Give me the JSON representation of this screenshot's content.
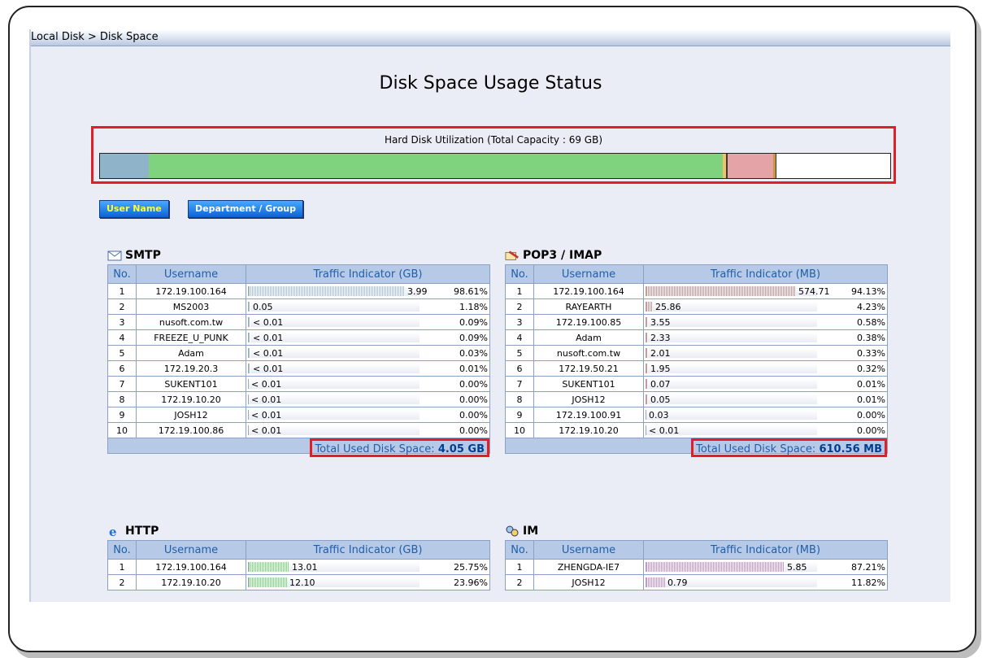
{
  "breadcrumb": "Local Disk > Disk Space",
  "page_title": "Disk Space Usage Status",
  "hard_disk": {
    "label": "Hard Disk Utilization (Total Capacity : 69 GB)",
    "segments": [
      {
        "color": "#8fb3c9",
        "fraction": 0.062
      },
      {
        "color": "#7fd37f",
        "fraction": 0.726
      },
      {
        "color": "#f2c26b",
        "fraction": 0.004
      },
      {
        "color": "#3a3a3a",
        "fraction": 0.002
      },
      {
        "color": "#e4a3a6",
        "fraction": 0.058
      },
      {
        "color": "#c99a3a",
        "fraction": 0.003
      }
    ]
  },
  "buttons": {
    "user_name": "User Name",
    "department_group": "Department / Group"
  },
  "sections": [
    {
      "key": "smtp",
      "title": "SMTP",
      "icon": "envelope-icon",
      "bar_color": "#a9c3d9",
      "headers": [
        "No.",
        "Username",
        "Traffic Indicator (GB)"
      ],
      "rows": [
        {
          "no": "1",
          "user": "172.19.100.164",
          "value": "3.99",
          "pct": "98.61%",
          "fraction": 0.9861
        },
        {
          "no": "2",
          "user": "MS2003",
          "value": "0.05",
          "pct": "1.18%",
          "fraction": 0.0118
        },
        {
          "no": "3",
          "user": "nusoft.com.tw",
          "value": "< 0.01",
          "pct": "0.09%",
          "fraction": 0.0009
        },
        {
          "no": "4",
          "user": "FREEZE_U_PUNK",
          "value": "< 0.01",
          "pct": "0.09%",
          "fraction": 0.0009
        },
        {
          "no": "5",
          "user": "Adam",
          "value": "< 0.01",
          "pct": "0.03%",
          "fraction": 0.0003
        },
        {
          "no": "6",
          "user": "172.19.20.3",
          "value": "< 0.01",
          "pct": "0.01%",
          "fraction": 0.0001
        },
        {
          "no": "7",
          "user": "SUKENT101",
          "value": "< 0.01",
          "pct": "0.00%",
          "fraction": 0
        },
        {
          "no": "8",
          "user": "172.19.10.20",
          "value": "< 0.01",
          "pct": "0.00%",
          "fraction": 0
        },
        {
          "no": "9",
          "user": "JOSH12",
          "value": "< 0.01",
          "pct": "0.00%",
          "fraction": 0
        },
        {
          "no": "10",
          "user": "172.19.100.86",
          "value": "< 0.01",
          "pct": "0.00%",
          "fraction": 0
        }
      ],
      "total_label": "Total Used Disk Space: ",
      "total_value": "4.05 GB"
    },
    {
      "key": "pop3",
      "title": "POP3 / IMAP",
      "icon": "mail-pen-icon",
      "bar_color": "#f08a8a",
      "headers": [
        "No.",
        "Username",
        "Traffic Indicator (MB)"
      ],
      "rows": [
        {
          "no": "1",
          "user": "172.19.100.164",
          "value": "574.71",
          "pct": "94.13%",
          "fraction": 0.9413
        },
        {
          "no": "2",
          "user": "RAYEARTH",
          "value": "25.86",
          "pct": "4.23%",
          "fraction": 0.0423
        },
        {
          "no": "3",
          "user": "172.19.100.85",
          "value": "3.55",
          "pct": "0.58%",
          "fraction": 0.0058
        },
        {
          "no": "4",
          "user": "Adam",
          "value": "2.33",
          "pct": "0.38%",
          "fraction": 0.0038
        },
        {
          "no": "5",
          "user": "nusoft.com.tw",
          "value": "2.01",
          "pct": "0.33%",
          "fraction": 0.0033
        },
        {
          "no": "6",
          "user": "172.19.50.21",
          "value": "1.95",
          "pct": "0.32%",
          "fraction": 0.0032
        },
        {
          "no": "7",
          "user": "SUKENT101",
          "value": "0.07",
          "pct": "0.01%",
          "fraction": 0.0001
        },
        {
          "no": "8",
          "user": "JOSH12",
          "value": "0.05",
          "pct": "0.01%",
          "fraction": 0.0001
        },
        {
          "no": "9",
          "user": "172.19.100.91",
          "value": "0.03",
          "pct": "0.00%",
          "fraction": 0
        },
        {
          "no": "10",
          "user": "172.19.10.20",
          "value": "< 0.01",
          "pct": "0.00%",
          "fraction": 0
        }
      ],
      "total_label": "Total Used Disk Space: ",
      "total_value": "610.56 MB"
    },
    {
      "key": "http",
      "title": "HTTP",
      "icon": "browser-e-icon",
      "bar_color": "#86d986",
      "headers": [
        "No.",
        "Username",
        "Traffic Indicator (GB)"
      ],
      "rows": [
        {
          "no": "1",
          "user": "172.19.100.164",
          "value": "13.01",
          "pct": "25.75%",
          "fraction": 0.2575
        },
        {
          "no": "2",
          "user": "172.19.10.20",
          "value": "12.10",
          "pct": "23.96%",
          "fraction": 0.2396
        }
      ]
    },
    {
      "key": "im",
      "title": "IM",
      "icon": "chat-people-icon",
      "bar_color": "#e58ae0",
      "headers": [
        "No.",
        "Username",
        "Traffic Indicator (MB)"
      ],
      "rows": [
        {
          "no": "1",
          "user": "ZHENGDA-IE7",
          "value": "5.85",
          "pct": "87.21%",
          "fraction": 0.8721
        },
        {
          "no": "2",
          "user": "JOSH12",
          "value": "0.79",
          "pct": "11.82%",
          "fraction": 0.1182
        }
      ]
    }
  ]
}
